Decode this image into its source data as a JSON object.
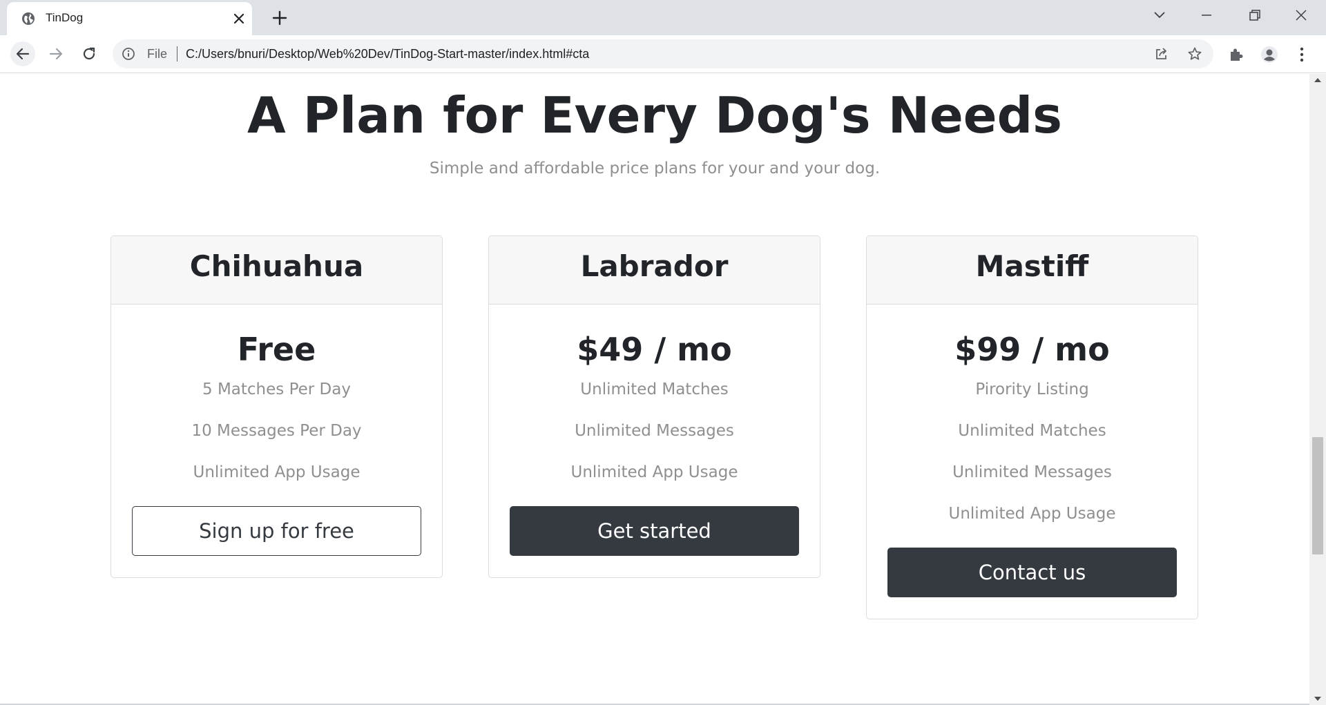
{
  "browser": {
    "tab_title": "TinDog",
    "omnibox": {
      "scheme_label": "File",
      "url": "C:/Users/bnuri/Desktop/Web%20Dev/TinDog-Start-master/index.html#cta"
    }
  },
  "page": {
    "heading": "A Plan for Every Dog's Needs",
    "subheading": "Simple and affordable price plans for your and your dog.",
    "plans": [
      {
        "name": "Chihuahua",
        "price": "Free",
        "features": [
          "5 Matches Per Day",
          "10 Messages Per Day",
          "Unlimited App Usage"
        ],
        "button_label": "Sign up for free",
        "button_style": "outline"
      },
      {
        "name": "Labrador",
        "price": "$49 / mo",
        "features": [
          "Unlimited Matches",
          "Unlimited Messages",
          "Unlimited App Usage"
        ],
        "button_label": "Get started",
        "button_style": "dark"
      },
      {
        "name": "Mastiff",
        "price": "$99 / mo",
        "features": [
          "Pirority Listing",
          "Unlimited Matches",
          "Unlimited Messages",
          "Unlimited App Usage"
        ],
        "button_label": "Contact us",
        "button_style": "dark"
      }
    ]
  },
  "colors": {
    "heading_text": "#212529",
    "muted_text": "#8f8f8f",
    "button_dark": "#343a40",
    "card_header_bg": "#f7f7f7",
    "chrome_tabstrip": "#dee1e6"
  },
  "icons": {
    "tab_favicon": "globe-icon",
    "tab_close": "close-icon",
    "new_tab": "plus-icon",
    "back": "arrow-left-icon",
    "forward": "arrow-right-icon",
    "reload": "reload-icon",
    "site_info": "info-icon",
    "share": "share-icon",
    "bookmark": "star-icon",
    "extensions": "puzzle-icon",
    "profile": "profile-icon",
    "menu": "kebab-menu-icon"
  }
}
